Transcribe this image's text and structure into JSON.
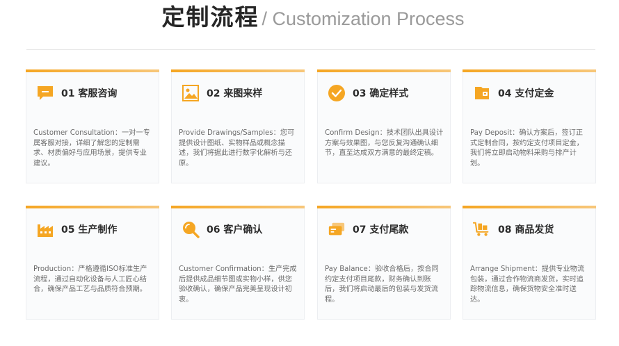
{
  "header": {
    "title_cn": "定制流程",
    "title_en": "/ Customization Process"
  },
  "theme": {
    "accent": "#f5a623",
    "accent_light": "#f7c77a"
  },
  "steps": [
    {
      "title": "01 客服咨询",
      "icon": "chat-bubble-icon",
      "desc": "Customer Consultation：一对一专属客服对接，详细了解您的定制需求、材质偏好与应用场景，提供专业建议。"
    },
    {
      "title": "02 来图来样",
      "icon": "image-icon",
      "desc": "Provide Drawings/Samples：您可提供设计图纸、实物样品或概念描述，我们将据此进行数字化解析与还原。"
    },
    {
      "title": "03 确定样式",
      "icon": "check-circle-icon",
      "desc": "Confirm Design：技术团队出具设计方案与效果图，与您反复沟通确认细节，直至达成双方满意的最终定稿。"
    },
    {
      "title": "04 支付定金",
      "icon": "wallet-icon",
      "desc": "Pay Deposit：确认方案后，签订正式定制合同，按约定支付项目定金，我们将立即启动物料采购与排产计划。"
    },
    {
      "title": "05 生产制作",
      "icon": "factory-icon",
      "desc": "Production：严格遵循ISO标准生产流程，通过自动化设备与人工匠心结合，确保产品工艺与品质符合预期。"
    },
    {
      "title": "06 客户确认",
      "icon": "magnifier-icon",
      "desc": "Customer Confirmation：生产完成后提供成品细节图或实物小样，供您验收确认，确保产品完美呈现设计初衷。"
    },
    {
      "title": "07 支付尾款",
      "icon": "payment-card-icon",
      "desc": "Pay Balance：验收合格后，按合同约定支付项目尾款，财务确认到账后，我们将启动最后的包装与发货流程。"
    },
    {
      "title": "08 商品发货",
      "icon": "shipping-cart-icon",
      "desc": "Arrange Shipment：提供专业物流包装，通过合作物流商发货，实时追踪物流信息，确保货物安全准时送达。"
    }
  ]
}
